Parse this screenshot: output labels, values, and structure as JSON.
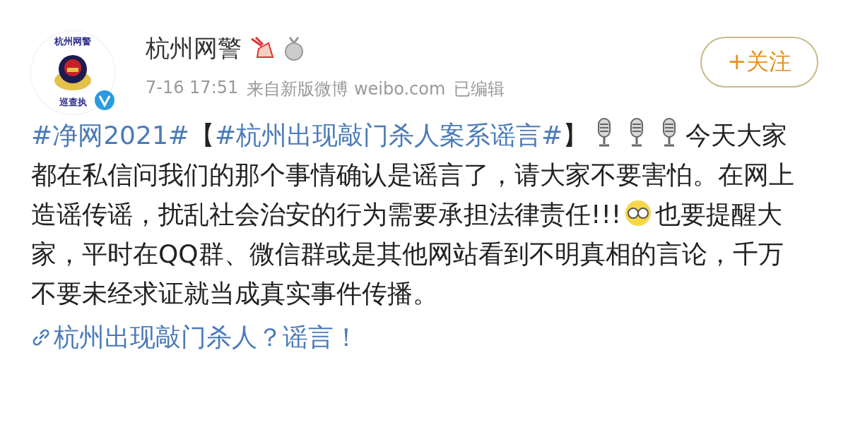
{
  "author": {
    "avatar_top_text": "杭州网警",
    "avatar_bottom_text": "巡查执",
    "verified": true,
    "name": "杭州网警",
    "time": "7-16 17:51",
    "source": "来自新版微博 weibo.com",
    "edited": "已编辑"
  },
  "follow_button": {
    "label": "+关注"
  },
  "post": {
    "segments": [
      {
        "kind": "topic",
        "text": "#净网2021#"
      },
      {
        "kind": "text",
        "text": "【"
      },
      {
        "kind": "topic",
        "text": "#杭州出现敲门杀人案系谣言#"
      },
      {
        "kind": "text",
        "text": "】"
      },
      {
        "kind": "mic"
      },
      {
        "kind": "mic"
      },
      {
        "kind": "mic"
      },
      {
        "kind": "text",
        "text": "今天大家都在私信问我们的那个事情确认是谣言了，请大家不要害怕。在网上造谣传谣，扰乱社会治安的行为需要承担法律责任!!!"
      },
      {
        "kind": "emoji"
      },
      {
        "kind": "text",
        "text": "也要提醒大家，平时在QQ群、微信群或是其他网站看到不明真相的言论，千万不要未经求证就当成真实事件传播。"
      }
    ]
  },
  "link": {
    "text": "杭州出现敲门杀人？谣言！"
  }
}
